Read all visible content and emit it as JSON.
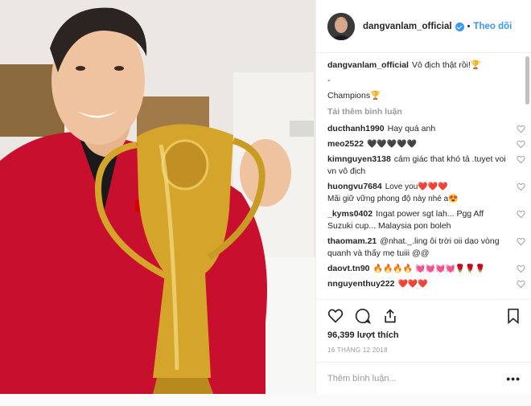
{
  "post": {
    "username": "dangvanlam_official",
    "follow_label": "Theo dõi",
    "dot": "•",
    "caption_user": "dangvanlam_official",
    "caption_line1": "Vô địch thật rồi!🏆",
    "caption_line2": "-",
    "caption_line3": "Champions🏆",
    "load_more": "Tải thêm bình luận",
    "likes": "96,399 lượt thích",
    "date": "16 THÁNG 12 2018",
    "comment_placeholder": "Thêm bình luận...",
    "more_options": "•••"
  },
  "comments": [
    {
      "user": "ducthanh1990",
      "text": "Hay quá anh"
    },
    {
      "user": "meo2522",
      "text": "🖤🖤🖤🖤🖤"
    },
    {
      "user": "kimnguyen3138",
      "text": "cảm giác that khó tả .tuyet voi vn vô địch"
    },
    {
      "user": "huongvu7684",
      "text": "Love you❤️❤️❤️\nMãi giữ vững phong độ này nhé a😍"
    },
    {
      "user": "_kyms0402",
      "text": "Ingat power sgt lah... Pgg Aff Suzuki cup... Malaysia pon boleh"
    },
    {
      "user": "thaomam.21",
      "text": "@nhat._.ling ôi trời oii dạo vòng quanh và thấy mẹ tuiii @@"
    },
    {
      "user": "daovt.tn90",
      "text": "🔥🔥🔥🔥 💓💓💓💓🌹🌹🌹"
    },
    {
      "user": "nnguyenthuy222",
      "text": "❤️❤️❤️"
    }
  ],
  "colors": {
    "accent": "#3897f0",
    "jersey": "#c8102e",
    "trophy": "#d4a52a"
  },
  "icons": [
    "verified-badge-icon",
    "heart-icon",
    "comment-icon",
    "share-icon",
    "bookmark-icon"
  ]
}
